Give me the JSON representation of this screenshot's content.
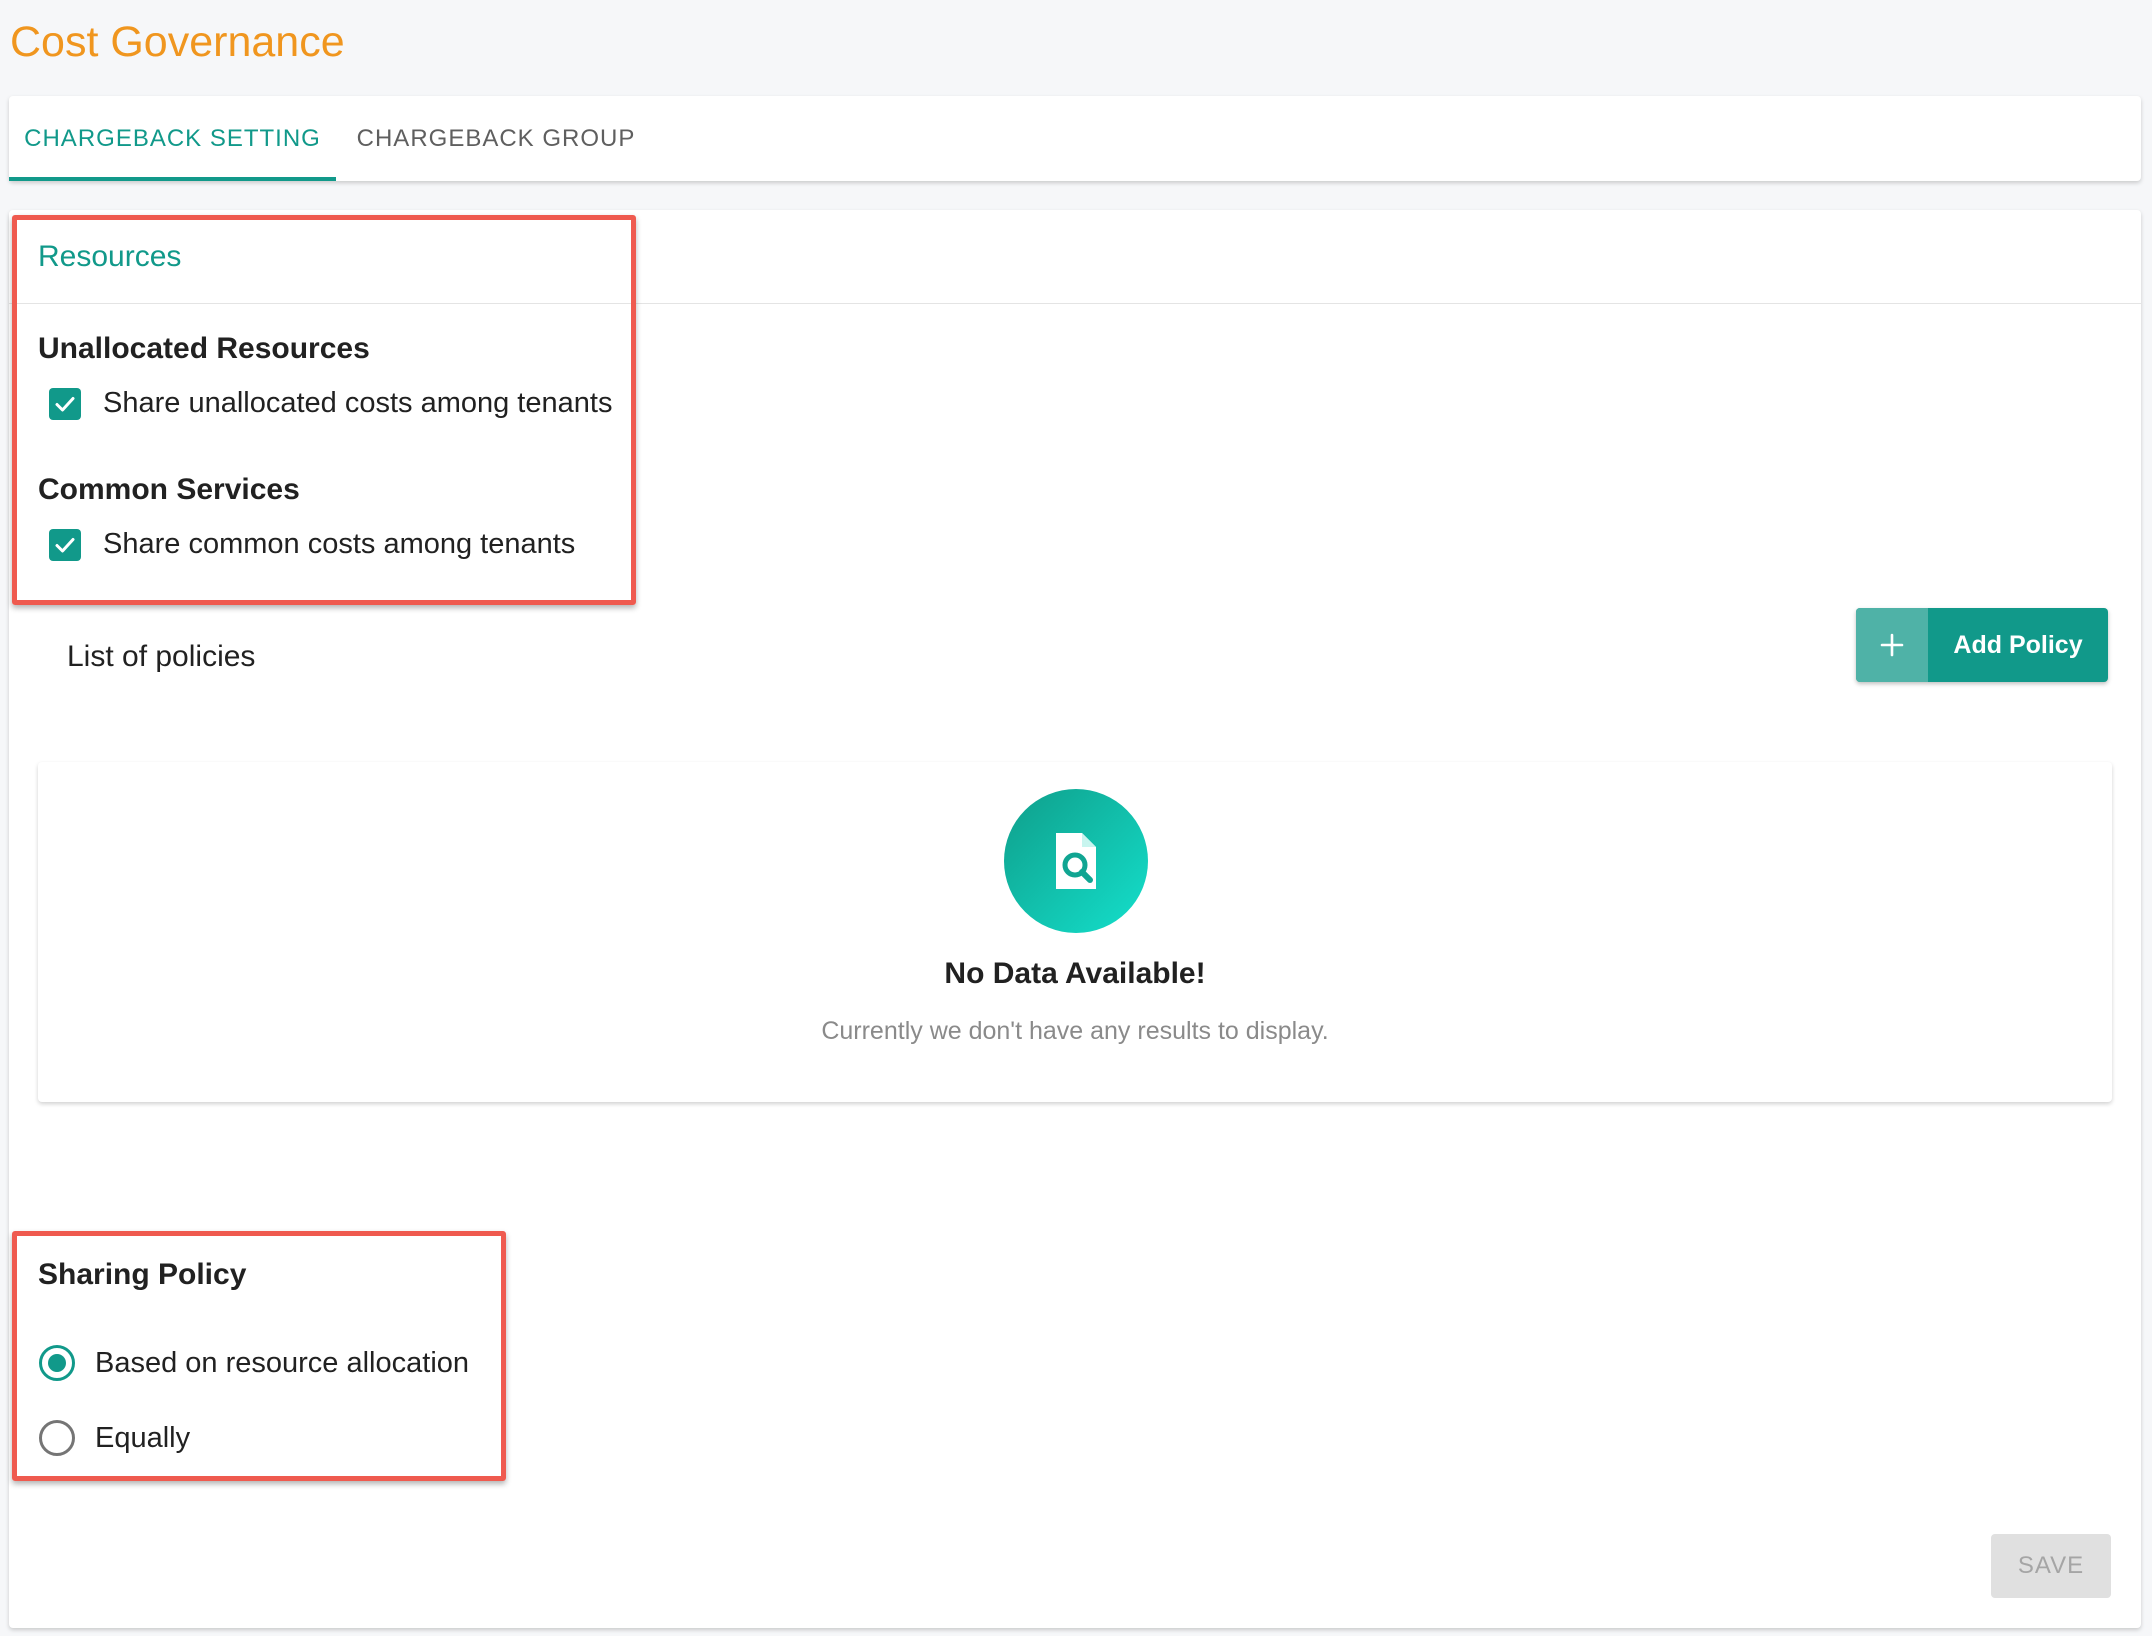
{
  "page": {
    "title": "Cost Governance"
  },
  "tabs": [
    {
      "label": "CHARGEBACK SETTING",
      "active": true
    },
    {
      "label": "CHARGEBACK GROUP",
      "active": false
    }
  ],
  "resources": {
    "heading": "Resources",
    "unallocated": {
      "title": "Unallocated Resources",
      "checkbox_label": "Share unallocated costs among tenants",
      "checked": true
    },
    "common": {
      "title": "Common Services",
      "checkbox_label": "Share common costs among tenants",
      "checked": true
    }
  },
  "policies": {
    "title": "List of policies",
    "add_button_label": "Add Policy",
    "add_button_icon": "plus-icon",
    "empty": {
      "icon": "document-search-icon",
      "title": "No Data Available!",
      "subtitle": "Currently we don't have any results to display."
    }
  },
  "sharing_policy": {
    "title": "Sharing Policy",
    "options": [
      {
        "label": "Based on resource allocation",
        "selected": true
      },
      {
        "label": "Equally",
        "selected": false
      }
    ]
  },
  "footer": {
    "save_label": "SAVE",
    "save_disabled": true
  },
  "colors": {
    "accent": "#11998a",
    "title": "#f0961f",
    "highlight": "#ef5a4f",
    "disabled_bg": "#e0e0e0"
  }
}
